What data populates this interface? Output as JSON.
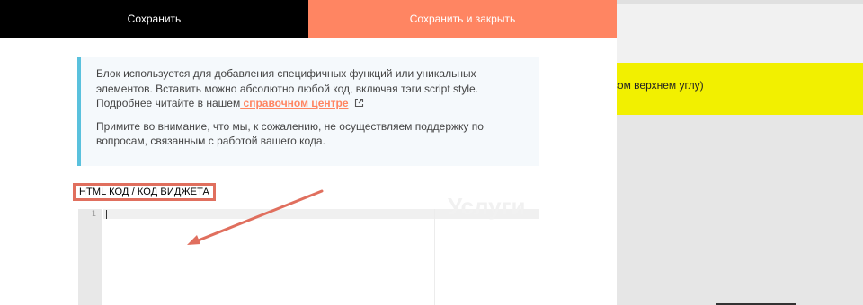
{
  "topbar": {
    "save_label": "Сохранить",
    "save_close_label": "Сохранить и закрыть"
  },
  "info": {
    "paragraph1_text": "Блок используется для добавления специфичных функций или уникальных элементов. Вставить можно абсолютно любой код, включая тэги script style. Подробнее читайте в нашем",
    "paragraph1_link": " справочном центре",
    "paragraph2_text": "Примите во внимание, что мы, к сожалению, не осуществляем поддержку по вопросам, связанным с работой вашего кода."
  },
  "field": {
    "label": "HTML КОД / КОД ВИДЖЕТА"
  },
  "editor": {
    "line_numbers": [
      "1"
    ],
    "content": ""
  },
  "background": {
    "yellow_text": "авом верхнем углу)",
    "watermark_text": "Услуги"
  },
  "colors": {
    "save_bg": "#000000",
    "save_close_bg": "#ff8562",
    "link": "#ff8562",
    "info_border": "#5ac1dd",
    "annotation": "#e06f5e",
    "yellow": "#f2f000"
  }
}
